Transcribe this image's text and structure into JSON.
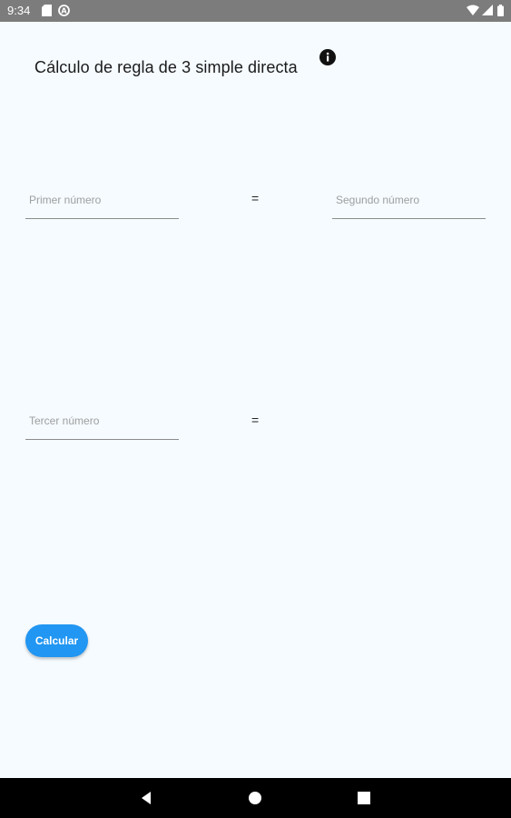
{
  "status": {
    "time": "9:34",
    "icons": [
      "sd-card-icon",
      "sync-icon",
      "wifi-icon",
      "signal-icon",
      "battery-icon"
    ]
  },
  "title": "Cálculo de regla de 3 simple directa",
  "info_icon": "info-icon",
  "inputs": {
    "first_placeholder": "Primer número",
    "second_placeholder": "Segundo número",
    "third_placeholder": "Tercer número",
    "first_value": "",
    "second_value": "",
    "third_value": ""
  },
  "equals_symbol": "=",
  "calculate_button": "Calcular",
  "colors": {
    "accent": "#2196f3",
    "background": "#f5fbff",
    "statusbar": "#7c7c7c",
    "navbar": "#000000"
  },
  "navbar": {
    "icons": [
      "back-icon",
      "home-icon",
      "recents-icon"
    ]
  }
}
